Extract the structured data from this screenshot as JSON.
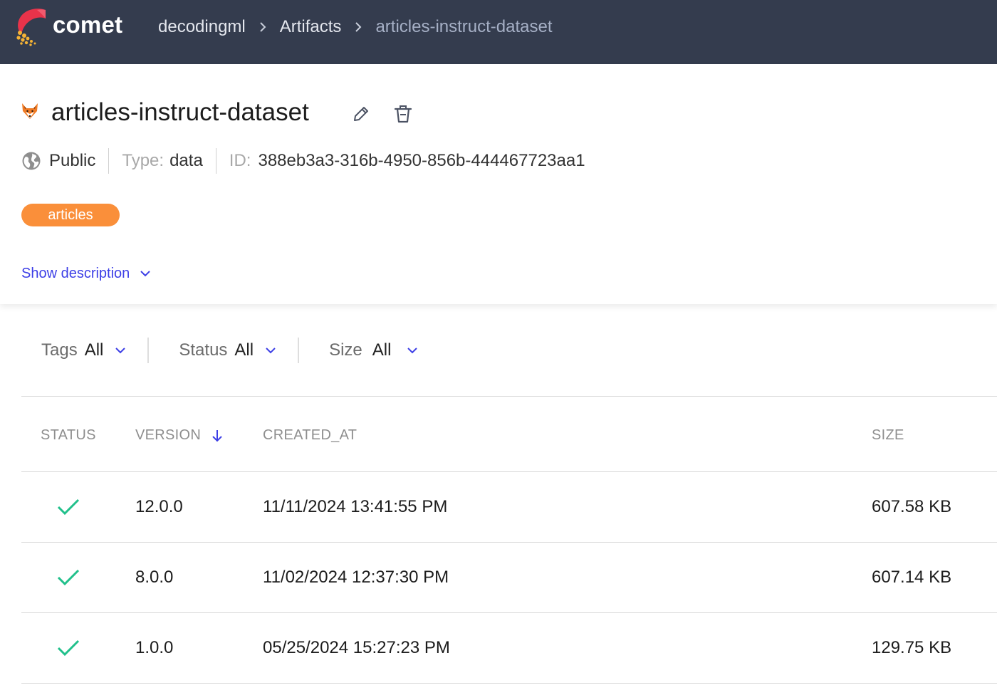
{
  "topbar": {
    "brand": "comet",
    "breadcrumbs": [
      "decodingml",
      "Artifacts",
      "articles-instruct-dataset"
    ]
  },
  "artifact": {
    "title": "articles-instruct-dataset",
    "visibility": "Public",
    "type_label": "Type:",
    "type_value": "data",
    "id_label": "ID:",
    "id_value": "388eb3a3-316b-4950-856b-444467723aa1",
    "tag": "articles",
    "show_description": "Show description"
  },
  "filters": [
    {
      "label": "Tags",
      "value": "All"
    },
    {
      "label": "Status",
      "value": "All"
    },
    {
      "label": "Size",
      "value": "All"
    }
  ],
  "table": {
    "columns": [
      "STATUS",
      "VERSION",
      "CREATED_AT",
      "SIZE"
    ],
    "rows": [
      {
        "status": "success",
        "version": "12.0.0",
        "created_at": "11/11/2024 13:41:55 PM",
        "size": "607.58 KB"
      },
      {
        "status": "success",
        "version": "8.0.0",
        "created_at": "11/02/2024 12:37:30 PM",
        "size": "607.14 KB"
      },
      {
        "status": "success",
        "version": "1.0.0",
        "created_at": "05/25/2024 15:27:23 PM",
        "size": "129.75 KB"
      }
    ]
  },
  "colors": {
    "topbar_bg": "#343c4e",
    "accent_link": "#3c3ee6",
    "tag_bg": "#fa8f3a",
    "check_green": "#21c08b"
  },
  "icons": {
    "logo": "comet-logo-icon",
    "artifact": "fox-icon",
    "edit": "pencil-icon",
    "delete": "trash-icon",
    "visibility": "globe-icon",
    "sort": "arrow-down-icon",
    "dropdown": "chevron-down-icon",
    "status": "check-icon"
  }
}
